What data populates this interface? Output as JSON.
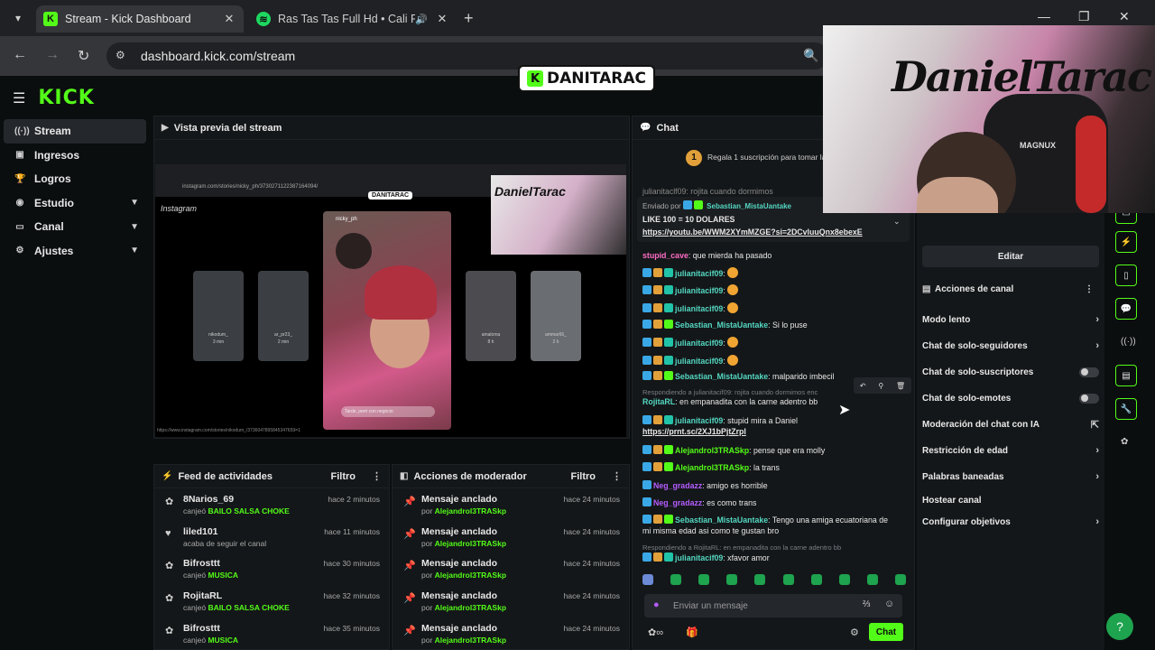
{
  "browser": {
    "tabs": [
      {
        "title": "Stream - Kick Dashboard",
        "favicon": "kick-icon"
      },
      {
        "title": "Ras Tas Tas Full Hd • Cali Fl",
        "favicon": "spotify-icon"
      }
    ],
    "url": "dashboard.kick.com/stream"
  },
  "overlay": {
    "channel_badge": "DANITARAC",
    "webcam_tag": "MAGNUX",
    "webcam_sign": "DanielTarac"
  },
  "sidebar": {
    "items": [
      {
        "label": "Stream",
        "icon": "stream-icon"
      },
      {
        "label": "Ingresos",
        "icon": "wallet-icon"
      },
      {
        "label": "Logros",
        "icon": "trophy-icon"
      },
      {
        "label": "Estudio",
        "icon": "studio-icon"
      },
      {
        "label": "Canal",
        "icon": "channel-icon"
      },
      {
        "label": "Ajustes",
        "icon": "gear-icon"
      }
    ]
  },
  "preview": {
    "title": "Vista previa del stream",
    "inner_url": "instagram.com/stories/nicky_ph/3730271122387164094/",
    "inner_site": "Instagram",
    "inner_badge": "DANITARAC",
    "stories": [
      {
        "name": "nikodum_",
        "time": "3 min"
      },
      {
        "name": "ar_pr23_",
        "time": "2 min"
      },
      {
        "name": "amaloma",
        "time": "8 h"
      },
      {
        "name": "ammar66_",
        "time": "2 h"
      }
    ],
    "story_user": "nicky_ph",
    "reply_placeholder": "Tarde, perri con negocio",
    "status_url": "https://www.instagram.com/stories/nikodum_/3736047895845347659=1"
  },
  "activity": {
    "title": "Feed de actividades",
    "filter": "Filtro",
    "rows": [
      {
        "name": "8Narios_69",
        "action": "canjeó",
        "reward": "BAILO SALSA CHOKE",
        "time": "hace 2 minutos"
      },
      {
        "name": "liled101",
        "action": "acaba de seguir el canal",
        "reward": "",
        "time": "hace 11 minutos"
      },
      {
        "name": "Bifrosttt",
        "action": "canjeó",
        "reward": "MUSICA",
        "time": "hace 30 minutos"
      },
      {
        "name": "RojitaRL",
        "action": "canjeó",
        "reward": "BAILO SALSA CHOKE",
        "time": "hace 32 minutos"
      },
      {
        "name": "Bifrosttt",
        "action": "canjeó",
        "reward": "MUSICA",
        "time": "hace 35 minutos"
      }
    ]
  },
  "mod": {
    "title": "Acciones de moderador",
    "filter": "Filtro",
    "rows": [
      {
        "name": "Mensaje anclado",
        "by": "por",
        "user": "Alejandrol3TRASkp",
        "time": "hace 24 minutos"
      },
      {
        "name": "Mensaje anclado",
        "by": "por",
        "user": "Alejandrol3TRASkp",
        "time": "hace 24 minutos"
      },
      {
        "name": "Mensaje anclado",
        "by": "por",
        "user": "Alejandrol3TRASkp",
        "time": "hace 24 minutos"
      },
      {
        "name": "Mensaje anclado",
        "by": "por",
        "user": "Alejandrol3TRASkp",
        "time": "hace 24 minutos"
      },
      {
        "name": "Mensaje anclado",
        "by": "por",
        "user": "Alejandrol3TRASkp",
        "time": "hace 24 minutos"
      }
    ]
  },
  "chat": {
    "title": "Chat",
    "sub_count": "1",
    "sub_text": "Regala 1 suscripción para tomar la",
    "partial_top": "julianitaclf09: rojita cuando dormimos",
    "pinned_by": "Enviado por",
    "pinned_user": "Sebastian_MistaUantake",
    "pinned_text": "LIKE 100 = 10 DOLARES",
    "pinned_link": "https://youtu.be/WWM2XYmMZGE?si=2DCvluuQnx8ebexE",
    "messages": [
      {
        "user": "stupid_cave",
        "text": ": que mierda ha pasado"
      },
      {
        "user": "julianitacif09",
        "text": ":"
      },
      {
        "user": "julianitacif09",
        "text": ":"
      },
      {
        "user": "julianitacif09",
        "text": ":"
      },
      {
        "user": "Sebastian_MistaUantake",
        "text": ": Si lo puse"
      },
      {
        "user": "julianitacif09",
        "text": ":"
      },
      {
        "user": "julianitacif09",
        "text": ":"
      },
      {
        "user": "Sebastian_MistaUantake",
        "text": ": malparido imbecil"
      },
      {
        "reply": "Respondiendo a julianitacif09: rojita cuando dormimos enc",
        "user": "RojitaRL",
        "text": ": en empanadita con la carne adentro bb"
      },
      {
        "user": "julianitacif09",
        "text": ": stupid mira a Daniel",
        "link": "https://prnt.sc/2XJ1bPjtZrpl"
      },
      {
        "user": "Alejandrol3TRASkp",
        "text": ": pense que era molly"
      },
      {
        "user": "Alejandrol3TRASkp",
        "text": ": la trans"
      },
      {
        "user": "Neg_gradazz",
        "text": ": amigo es horrible"
      },
      {
        "user": "Neg_gradazz",
        "text": ": es como trans"
      },
      {
        "user": "Sebastian_MistaUantake",
        "text": ": Tengo una amiga ecuatoriana de",
        "text2": "mi misma edad asi como te gustan bro"
      },
      {
        "reply": "Respondiendo a RojitaRL: en empanadita con la carne adentro bb",
        "user": "julianitacif09",
        "text": ": xfavor amor"
      }
    ],
    "input_placeholder": "Enviar un mensaje",
    "send_label": "Chat"
  },
  "right_panel": {
    "edit_label": "Editar",
    "actions_title": "Acciones de canal",
    "rows": [
      {
        "label": "Modo lento",
        "control": "chevron"
      },
      {
        "label": "Chat de solo-seguidores",
        "control": "chevron"
      },
      {
        "label": "Chat de solo-suscriptores",
        "control": "toggle"
      },
      {
        "label": "Chat de solo-emotes",
        "control": "toggle"
      },
      {
        "label": "Moderación del chat con IA",
        "control": "external"
      },
      {
        "label": "Restricción de edad",
        "control": "chevron"
      },
      {
        "label": "Palabras baneadas",
        "control": "chevron"
      },
      {
        "label": "Hostear canal",
        "control": "none"
      },
      {
        "label": "Configurar objetivos",
        "control": "chevron"
      }
    ]
  },
  "colors": {
    "accent": "#53fc18",
    "background": "#0b0e0f",
    "panel": "#141719"
  }
}
